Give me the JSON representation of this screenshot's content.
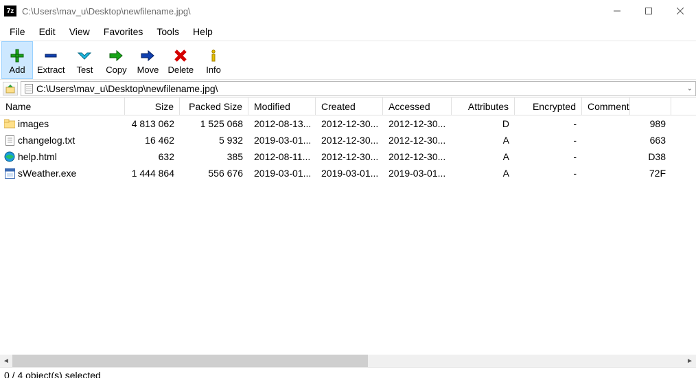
{
  "window": {
    "title": "C:\\Users\\mav_u\\Desktop\\newfilename.jpg\\"
  },
  "menu": [
    "File",
    "Edit",
    "View",
    "Favorites",
    "Tools",
    "Help"
  ],
  "toolbar": [
    {
      "id": "add",
      "label": "Add",
      "selected": true
    },
    {
      "id": "extract",
      "label": "Extract",
      "selected": false
    },
    {
      "id": "test",
      "label": "Test",
      "selected": false
    },
    {
      "id": "copy",
      "label": "Copy",
      "selected": false
    },
    {
      "id": "move",
      "label": "Move",
      "selected": false
    },
    {
      "id": "delete",
      "label": "Delete",
      "selected": false
    },
    {
      "id": "info",
      "label": "Info",
      "selected": false
    }
  ],
  "address": "C:\\Users\\mav_u\\Desktop\\newfilename.jpg\\",
  "columns": [
    "Name",
    "Size",
    "Packed Size",
    "Modified",
    "Created",
    "Accessed",
    "Attributes",
    "Encrypted",
    "Comment",
    ""
  ],
  "rows": [
    {
      "icon": "folder",
      "name": "images",
      "size": "4 813 062",
      "packed": "1 525 068",
      "mod": "2012-08-13...",
      "crt": "2012-12-30...",
      "acc": "2012-12-30...",
      "attr": "D",
      "enc": "-",
      "comment": "",
      "crc": "989"
    },
    {
      "icon": "txt",
      "name": "changelog.txt",
      "size": "16 462",
      "packed": "5 932",
      "mod": "2019-03-01...",
      "crt": "2012-12-30...",
      "acc": "2012-12-30...",
      "attr": "A",
      "enc": "-",
      "comment": "",
      "crc": "663"
    },
    {
      "icon": "html",
      "name": "help.html",
      "size": "632",
      "packed": "385",
      "mod": "2012-08-11...",
      "crt": "2012-12-30...",
      "acc": "2012-12-30...",
      "attr": "A",
      "enc": "-",
      "comment": "",
      "crc": "D38"
    },
    {
      "icon": "exe",
      "name": "sWeather.exe",
      "size": "1 444 864",
      "packed": "556 676",
      "mod": "2019-03-01...",
      "crt": "2019-03-01...",
      "acc": "2019-03-01...",
      "attr": "A",
      "enc": "-",
      "comment": "",
      "crc": "72F"
    }
  ],
  "status": "0 / 4 object(s) selected"
}
